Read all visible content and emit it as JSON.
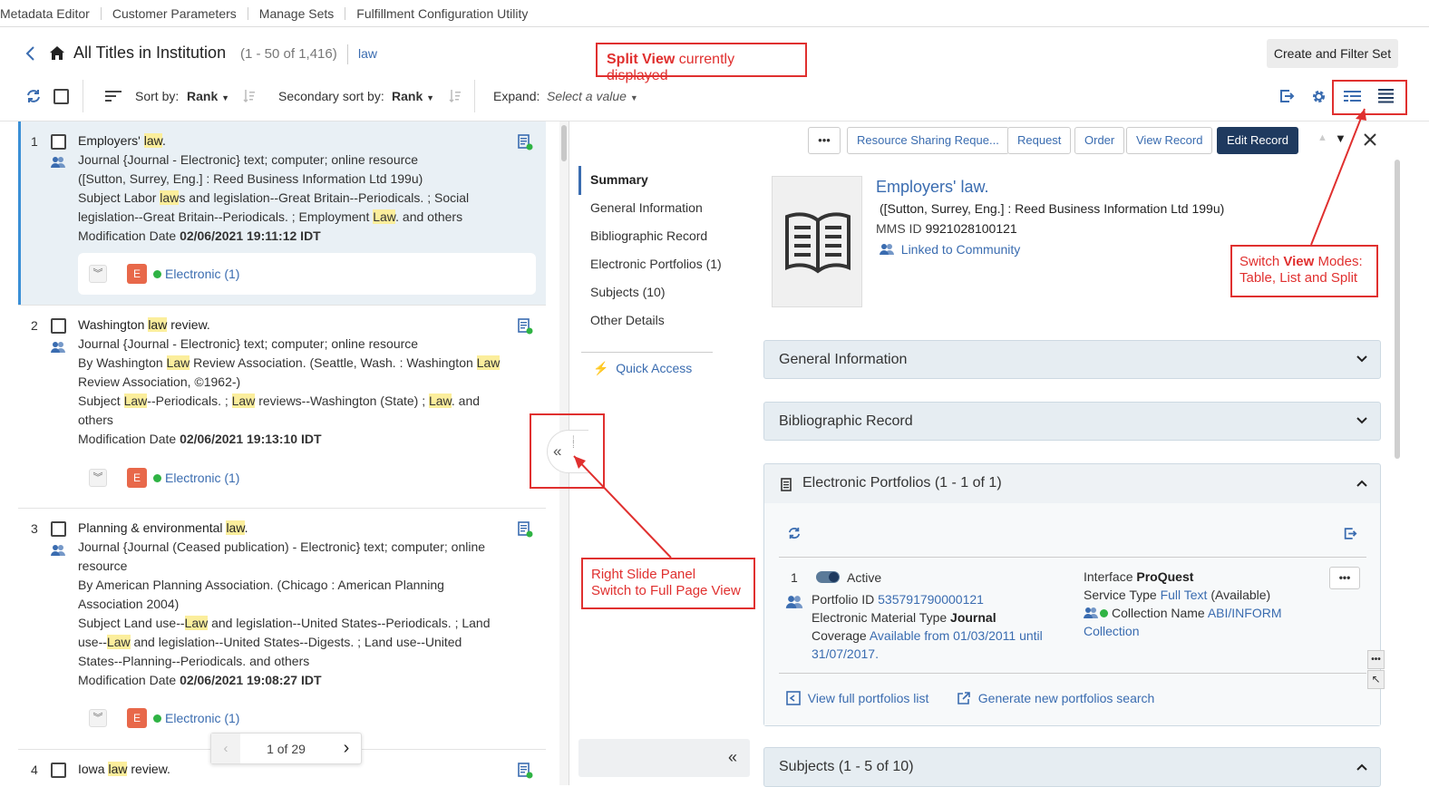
{
  "topnav": [
    "Metadata Editor",
    "Customer Parameters",
    "Manage Sets",
    "Fulfillment Configuration Utility"
  ],
  "header": {
    "title": "All Titles in Institution",
    "count": "(1 - 50 of 1,416)",
    "query": "law",
    "create_set": "Create and Filter Set"
  },
  "toolbar": {
    "sort_label": "Sort by:",
    "sort_value": "Rank",
    "secondary_label": "Secondary sort by:",
    "secondary_value": "Rank",
    "expand_label": "Expand:",
    "expand_placeholder": "Select a value"
  },
  "results": [
    {
      "num": "1",
      "title": [
        "Employers' ",
        "law",
        "."
      ],
      "type": "Journal {Journal - Electronic} text; computer; online resource",
      "pub": "([Sutton, Surrey, Eng.] : Reed Business Information Ltd 199u)",
      "subject": [
        "Subject Labor ",
        "law",
        "s and legislation--Great Britain--Periodicals. ; Social legislation--Great Britain--Periodicals. ; Employment ",
        "Law",
        ". and others"
      ],
      "mod_label": "Modification Date ",
      "mod_date": "02/06/2021 19:11:12 IDT",
      "badge": "E",
      "avail": "Electronic (1)"
    },
    {
      "num": "2",
      "title": [
        "Washington ",
        "law",
        " review."
      ],
      "type": "Journal {Journal - Electronic} text; computer; online resource",
      "pub": [
        "By Washington ",
        "Law",
        " Review Association. (Seattle, Wash. : Washington ",
        "Law",
        " Review Association, ©1962-)"
      ],
      "subject": [
        "Subject ",
        "Law",
        "--Periodicals. ; ",
        "Law",
        " reviews--Washington (State) ; ",
        "Law",
        ". and others"
      ],
      "mod_label": "Modification Date ",
      "mod_date": "02/06/2021 19:13:10 IDT",
      "badge": "E",
      "avail": "Electronic (1)"
    },
    {
      "num": "3",
      "title": [
        "Planning & environmental ",
        "law",
        "."
      ],
      "type": "Journal {Journal (Ceased publication) - Electronic} text; computer; online resource",
      "pub": "By American Planning Association. (Chicago : American Planning Association 2004)",
      "subject": [
        "Subject Land use--",
        "Law",
        " and legislation--United States--Periodicals. ; Land use--",
        "Law",
        " and legislation--United States--Digests. ; Land use--United States--Planning--Periodicals. and others"
      ],
      "mod_label": "Modification Date ",
      "mod_date": "02/06/2021 19:08:27 IDT",
      "badge": "E",
      "avail": "Electronic (1)"
    },
    {
      "num": "4",
      "title": [
        "Iowa ",
        "law",
        " review."
      ]
    }
  ],
  "pager": {
    "text": "1 of 29"
  },
  "record_actions": {
    "more": "•••",
    "resource_sharing": "Resource Sharing Reque...",
    "request": "Request",
    "order": "Order",
    "view_record": "View Record",
    "edit_record": "Edit Record"
  },
  "sidenav": {
    "items": [
      "Summary",
      "General Information",
      "Bibliographic Record",
      "Electronic Portfolios (1)",
      "Subjects (10)",
      "Other Details"
    ],
    "quick_access": "Quick Access"
  },
  "record": {
    "title": "Employers' law.",
    "pub": "([Sutton, Surrey, Eng.] : Reed Business Information Ltd 199u)",
    "mms_label": "MMS ID ",
    "mms_id": "9921028100121",
    "linked": "Linked to Community"
  },
  "sections": {
    "general": "General Information",
    "biblio": "Bibliographic Record",
    "portfolios": "Electronic Portfolios (1 - 1 of 1)",
    "subjects": "Subjects (1 - 5 of 10)"
  },
  "portfolio": {
    "num": "1",
    "status": "Active",
    "portfolio_id_label": "Portfolio ID ",
    "portfolio_id": "535791790000121",
    "material_label": "Electronic Material Type ",
    "material": "Journal",
    "coverage_label": "Coverage ",
    "coverage": "Available from 01/03/2011 until 31/07/2017.",
    "interface_label": "Interface ",
    "interface": "ProQuest",
    "service_label": "Service Type ",
    "service": "Full Text",
    "service_status": "(Available)",
    "collection_label": "Collection Name ",
    "collection": "ABI/INFORM Collection",
    "view_full": "View full portfolios list",
    "generate": "Generate new portfolios search"
  },
  "annotations": {
    "split_bold": "Split View",
    "split_rest": " currently displayed",
    "switch_a": "Switch ",
    "switch_bold": "View",
    "switch_b": " Modes:",
    "switch_line2": "Table, List and Split",
    "slide_line1": "Right Slide Panel",
    "slide_line2": "Switch to Full Page View"
  },
  "colors": {
    "accent": "#3a6cb0",
    "annotation": "#e0302f",
    "edit_button": "#1f3a5f",
    "badge": "#e8684a",
    "available": "#2fb344"
  }
}
